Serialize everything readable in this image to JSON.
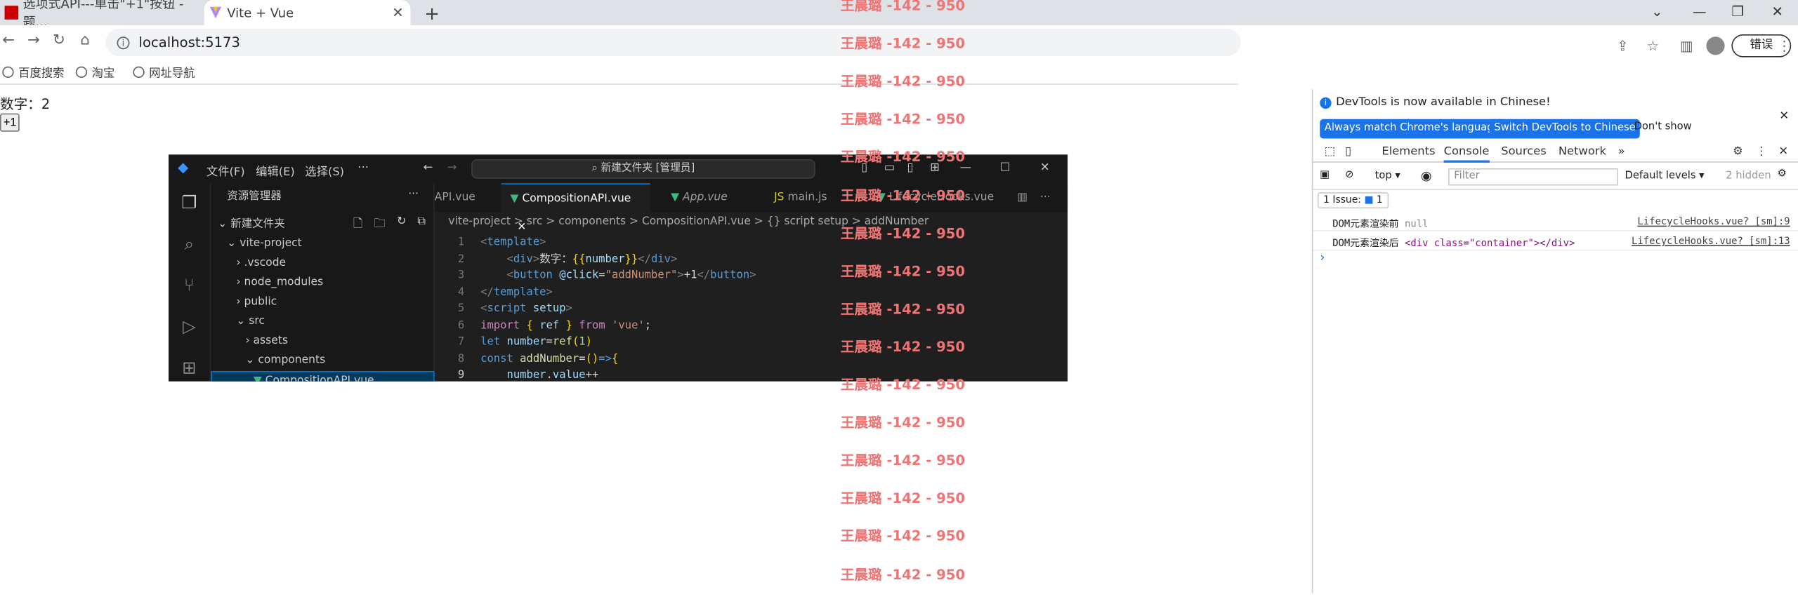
{
  "browser": {
    "tabs": [
      {
        "title": "选项式API---单击\"+1\"按钮 -题..."
      },
      {
        "title": "Vite + Vue"
      }
    ],
    "url": "localhost:5173",
    "error_button": "错误",
    "bookmarks": [
      "百度搜索",
      "淘宝",
      "网址导航"
    ]
  },
  "page": {
    "number_text": "数字：2",
    "button_label": "+1"
  },
  "devtools": {
    "banner": "DevTools is now available in Chinese!",
    "btn_match": "Always match Chrome's language",
    "btn_switch": "Switch DevTools to Chinese",
    "btn_dont": "Don't show",
    "tabs": [
      "Elements",
      "Console",
      "Sources",
      "Network",
      "»"
    ],
    "context": "top ▾",
    "filter_placeholder": "Filter",
    "levels": "Default levels ▾",
    "hidden": "2 hidden",
    "issue_label": "1 Issue:",
    "issue_count": "1",
    "logs": [
      {
        "msg": "DOM元素渲染前",
        "val": "null",
        "src": "LifecycleHooks.vue? [sm]:9"
      },
      {
        "msg": "DOM元素渲染后",
        "val": "<div class=\"container\"></div>",
        "src": "LifecycleHooks.vue? [sm]:13"
      }
    ],
    "prompt": "›"
  },
  "vscode": {
    "menu": [
      "文件(F)",
      "编辑(E)",
      "选择(S)",
      "···"
    ],
    "command_center": "新建文件夹 [管理员]",
    "explorer_title": "资源管理器",
    "tree": [
      "新建文件夹",
      "vite-project",
      ".vscode",
      "node_modules",
      "public",
      "src",
      "assets",
      "components",
      "CompositionAPI.vue"
    ],
    "editor_tabs": [
      "API.vue",
      "CompositionAPI.vue",
      "App.vue",
      "main.js",
      "LifecycleHooks.vue"
    ],
    "breadcrumb": "vite-project  >  src  >  components  >  CompositionAPI.vue  >  {} script setup  >  addNumber",
    "code_lines": [
      "<template>",
      "    <div>数字：{{number}}</div>",
      "    <button @click=\"addNumber\">+1</button>",
      "</template>",
      "<script setup>",
      "import { ref } from 'vue';",
      "let number=ref(1)",
      "const addNumber=()=>{",
      "    number.value++"
    ]
  },
  "watermark": "王晨璐 -142 - 950",
  "colors": {
    "accent": "#1a73e8",
    "watermark": "#f07474",
    "vscode_bg": "#1f1f1f"
  }
}
